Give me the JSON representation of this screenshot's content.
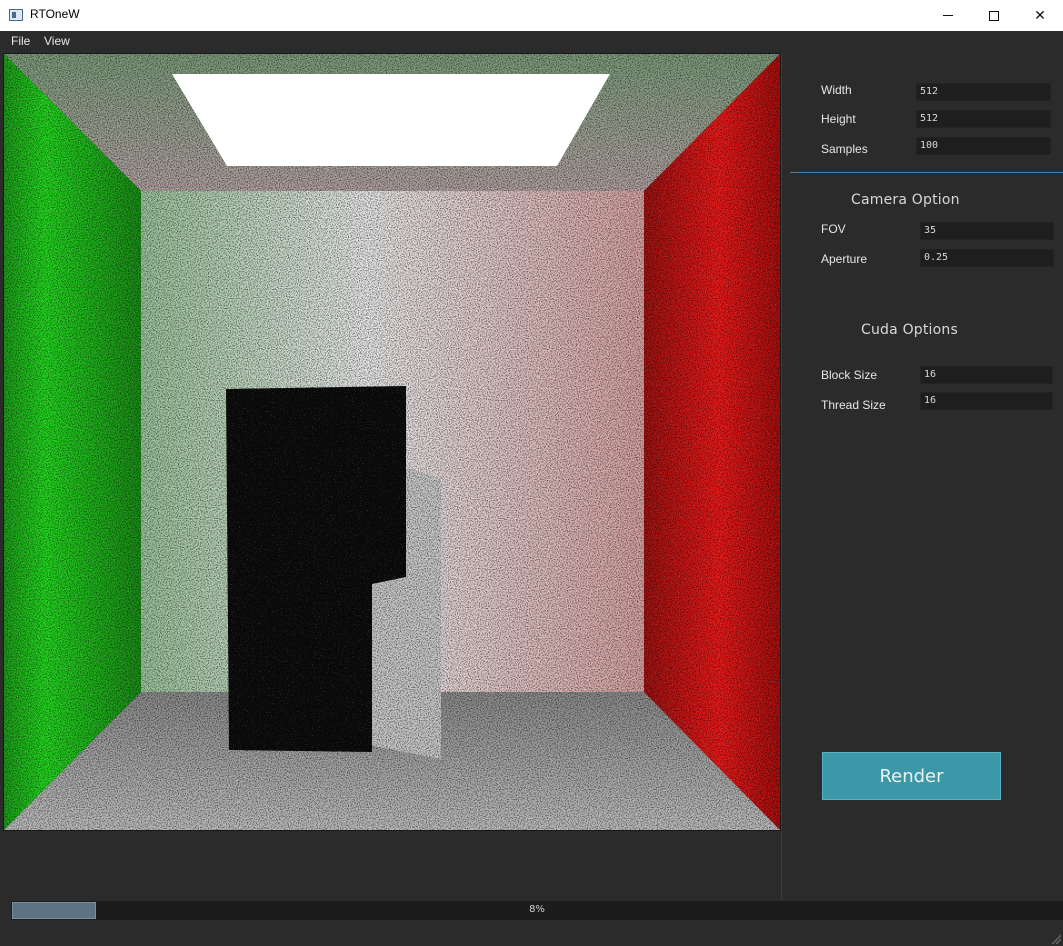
{
  "window": {
    "title": "RTOneW"
  },
  "menu": {
    "file": "File",
    "view": "View"
  },
  "settings": {
    "width_label": "Width",
    "width_value": "512",
    "height_label": "Height",
    "height_value": "512",
    "samples_label": "Samples",
    "samples_value": "100"
  },
  "camera": {
    "title": "Camera Option",
    "fov_label": "FOV",
    "fov_value": "35",
    "aperture_label": "Aperture",
    "aperture_value": "0.25"
  },
  "cuda": {
    "title": "Cuda Options",
    "block_label": "Block Size",
    "block_value": "16",
    "thread_label": "Thread Size",
    "thread_value": "16"
  },
  "render_button": "Render",
  "progress": {
    "percent": 8,
    "text": "8%"
  },
  "colors": {
    "accent": "#3c98a8",
    "progress_fill": "#5d7383",
    "background": "#2b2b2b",
    "left_wall": "#22c81e",
    "right_wall": "#e01414"
  }
}
